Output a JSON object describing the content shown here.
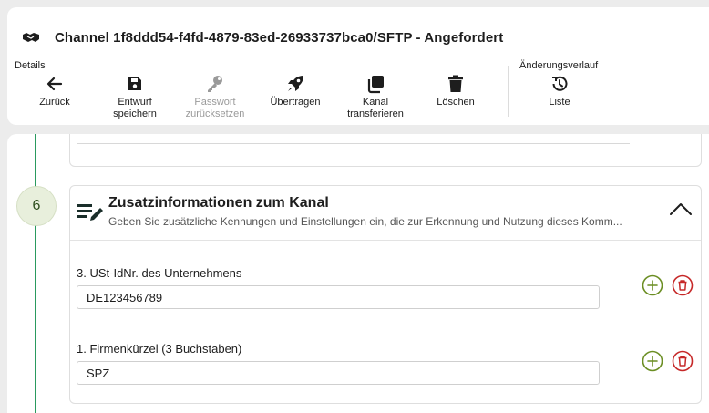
{
  "header": {
    "icon": "handshake-icon",
    "title": "Channel 1f8ddd54-f4fd-4879-83ed-26933737bca0/SFTP - Angefordert"
  },
  "toolbar": {
    "details_label": "Details",
    "history_label": "Änderungsverlauf",
    "back": {
      "icon": "arrow-left-icon",
      "label": "Zurück"
    },
    "save": {
      "icon": "floppy-disk-icon",
      "label_1": "Entwurf",
      "label_2": "speichern"
    },
    "reset_password": {
      "icon": "key-icon",
      "label_1": "Passwort",
      "label_2": "zurücksetzen"
    },
    "transmit": {
      "icon": "rocket-icon",
      "label": "Übertragen"
    },
    "transfer": {
      "icon": "copy-icon",
      "label_1": "Kanal",
      "label_2": "transferieren"
    },
    "delete": {
      "icon": "trash-icon",
      "label": "Löschen"
    },
    "history_list": {
      "icon": "history-icon",
      "label": "Liste"
    }
  },
  "stepper": {
    "step_number": "6"
  },
  "section": {
    "icon": "edit-note-icon",
    "title": "Zusatzinformationen zum Kanal",
    "description": "Geben Sie zusätzliche Kennungen und Einstellungen ein, die zur Erkennung und Nutzung dieses Komm..."
  },
  "fields": [
    {
      "label": "3. USt-IdNr. des Unternehmens",
      "value": "DE123456789"
    },
    {
      "label": "1. Firmenkürzel (3 Buchstaben)",
      "value": "SPZ"
    }
  ],
  "colors": {
    "accent_green": "#2a9a5e",
    "add_olive": "#6b8e23",
    "delete_red": "#c62828"
  }
}
